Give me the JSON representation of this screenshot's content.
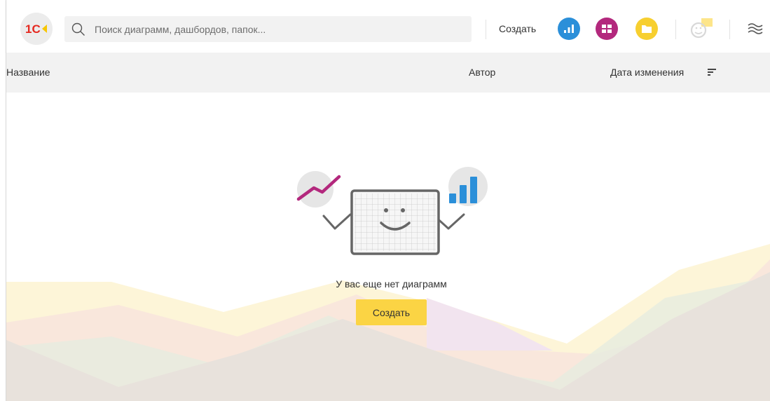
{
  "header": {
    "logo_text": "1C",
    "search_placeholder": "Поиск диаграмм, дашбордов, папок...",
    "create_label": "Создать",
    "create_icons": [
      "chart-icon",
      "dashboard-icon",
      "folder-icon"
    ],
    "feedback_icon": "feedback-smiley-icon",
    "menu_icon": "waves-menu-icon"
  },
  "table": {
    "columns": [
      {
        "label": "Название"
      },
      {
        "label": "Автор"
      },
      {
        "label": "Дата изменения",
        "sort_icon": "sort-icon"
      }
    ]
  },
  "empty_state": {
    "message": "У вас еще нет диаграмм",
    "button_label": "Создать"
  },
  "colors": {
    "accent_yellow": "#fbd444",
    "chart_blue": "#2b8fd9",
    "dashboard_purple": "#b3287d",
    "folder_yellow": "#f7cf30",
    "header_bg": "#f2f2f2"
  }
}
